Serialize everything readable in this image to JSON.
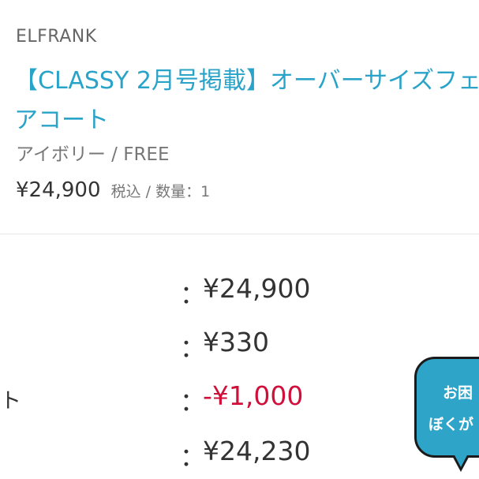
{
  "product": {
    "brand": "ELFRANK",
    "title": "【CLASSY 2月号掲載】オーバーサイズフェアコート",
    "variant": "アイボリー / FREE",
    "price": "¥24,900",
    "price_note": "税込 / 数量：1"
  },
  "summary": {
    "rows": [
      {
        "label": "",
        "colon": "：",
        "value": "¥24,900"
      },
      {
        "label": "",
        "colon": "：",
        "value": "¥330"
      },
      {
        "label": "ト",
        "colon": "：",
        "value": "-¥1,000"
      },
      {
        "label": "",
        "colon": "：",
        "value": "¥24,230"
      }
    ],
    "discount_color": "#d0103a"
  },
  "help_bubble": {
    "line1": "お困",
    "line2": "ぼくが",
    "color": "#2da4c8"
  },
  "colors": {
    "title": "#2aa3c9",
    "text": "#333333",
    "muted": "#777777"
  }
}
